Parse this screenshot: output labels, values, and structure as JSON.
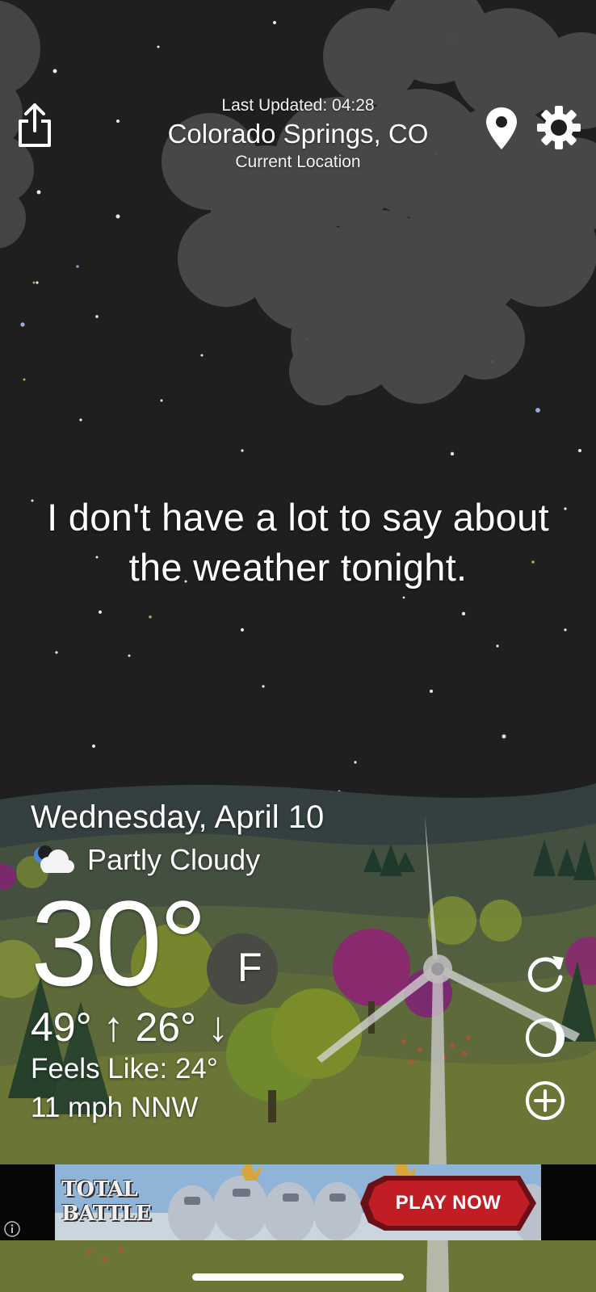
{
  "header": {
    "last_updated": "Last Updated: 04:28",
    "city": "Colorado Springs, CO",
    "location_label": "Current Location"
  },
  "icons": {
    "share": "share-icon",
    "location": "location-pin-icon",
    "settings": "gear-icon",
    "condition": "partly-cloudy-night-icon",
    "refresh": "refresh-icon",
    "moon": "moon-phase-icon",
    "add": "add-location-icon",
    "ad_info": "info-icon"
  },
  "message": "I don't have a lot to say about the weather tonight.",
  "conditions": {
    "date": "Wednesday, April 10",
    "condition": "Partly Cloudy",
    "temperature": "30°",
    "unit": "F",
    "high": "49°",
    "low": "26°",
    "feels_like": "Feels Like: 24°",
    "wind": "11 mph NNW"
  },
  "ad": {
    "title": "TOTAL BATTLE",
    "cta": "PLAY NOW"
  },
  "colors": {
    "sky": "#1f1f20",
    "cloud": "#4a4a4a",
    "hill_far": "#3b4848",
    "hill_mid": "#4f5a45",
    "grass": "#5b6634",
    "text": "#ffffff",
    "ad_cta": "#b3161f"
  }
}
